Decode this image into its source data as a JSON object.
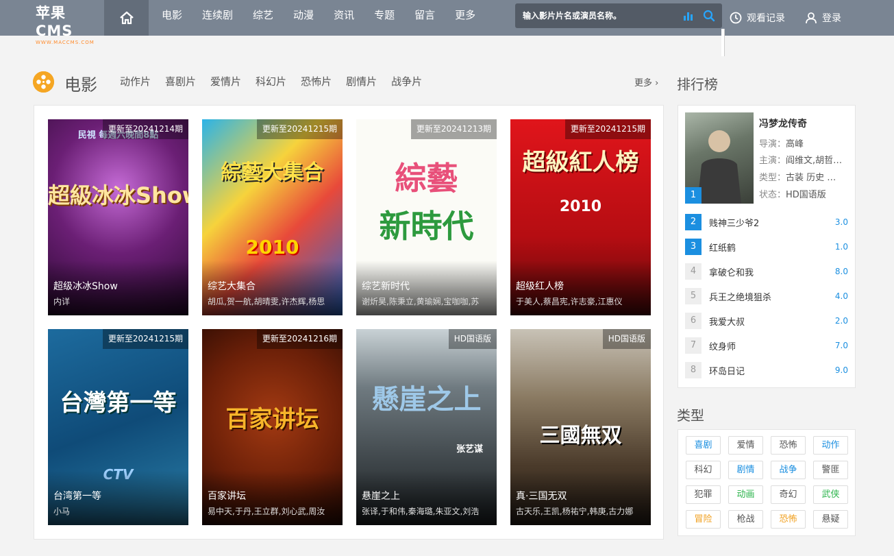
{
  "header": {
    "logo_main": "苹果 CMS",
    "logo_sub": "WWW.MACCMS.COM",
    "nav": [
      "电影",
      "连续剧",
      "综艺",
      "动漫",
      "资讯",
      "专题",
      "留言",
      "更多"
    ],
    "search_placeholder": "输入影片片名或演员名称。",
    "history_label": "观看记录",
    "login_label": "登录"
  },
  "section": {
    "title": "电影",
    "categories": [
      "动作片",
      "喜剧片",
      "爱情片",
      "科幻片",
      "恐怖片",
      "剧情片",
      "战争片"
    ],
    "more_label": "更多"
  },
  "cards": [
    {
      "title": "超级冰冰Show",
      "actors": "内详",
      "badge": "更新至20241214期",
      "art": "超級冰冰Show",
      "art_top": "民視 每週六晚間8點"
    },
    {
      "title": "综艺大集合",
      "actors": "胡瓜,贺一航,胡晴雯,许杰辉,杨思",
      "badge": "更新至20241215期",
      "art": "綜藝大集合",
      "art_top": "2010"
    },
    {
      "title": "综艺新时代",
      "actors": "谢炘昊,陈秉立,黄瑜娴,宝咖咖,苏",
      "badge": "更新至20241213期",
      "art": "綜藝",
      "art_top": "新時代"
    },
    {
      "title": "超级红人榜",
      "actors": "于美人,蔡昌宪,许志豪,江惠仪",
      "badge": "更新至20241215期",
      "art": "超級紅人榜",
      "art_top": "2010"
    },
    {
      "title": "台湾第一等",
      "actors": "小马",
      "badge": "更新至20241215期",
      "art": "台灣第一等",
      "art_top": "CTV"
    },
    {
      "title": "百家讲坛",
      "actors": "易中天,于丹,王立群,刘心武,周汝",
      "badge": "更新至20241216期",
      "art": "百家讲坛",
      "art_top": ""
    },
    {
      "title": "悬崖之上",
      "actors": "张译,于和伟,秦海璐,朱亚文,刘浩",
      "badge": "HD国语版",
      "art": "懸崖之上",
      "art_top": "张艺谋"
    },
    {
      "title": "真·三国无双",
      "actors": "古天乐,王凯,杨祐宁,韩庚,古力娜",
      "badge": "HD国语版",
      "art": "三國無双",
      "art_top": ""
    }
  ],
  "ranking": {
    "title": "排行榜",
    "top": {
      "rank": "1",
      "name": "冯梦龙传奇",
      "director_label": "导演：",
      "director": "高峰",
      "cast_label": "主演：",
      "cast": "阎维文,胡哲…",
      "type_label": "类型：",
      "type": "古装  历史  …",
      "status_label": "状态：",
      "status": "HD国语版"
    },
    "items": [
      {
        "rank": "2",
        "name": "贱神三少爷2",
        "score": "3.0"
      },
      {
        "rank": "3",
        "name": "红纸鹤",
        "score": "1.0"
      },
      {
        "rank": "4",
        "name": "拿破仑和我",
        "score": "8.0"
      },
      {
        "rank": "5",
        "name": "兵王之绝境狙杀",
        "score": "4.0"
      },
      {
        "rank": "6",
        "name": "我爱大叔",
        "score": "2.0"
      },
      {
        "rank": "7",
        "name": "纹身师",
        "score": "7.0"
      },
      {
        "rank": "8",
        "name": "环岛日记",
        "score": "9.0"
      }
    ]
  },
  "types": {
    "title": "类型",
    "tags": [
      {
        "label": "喜剧",
        "color": "#1b8fe0"
      },
      {
        "label": "爱情",
        "color": "#555555"
      },
      {
        "label": "恐怖",
        "color": "#555555"
      },
      {
        "label": "动作",
        "color": "#1b8fe0"
      },
      {
        "label": "科幻",
        "color": "#555555"
      },
      {
        "label": "剧情",
        "color": "#1b8fe0"
      },
      {
        "label": "战争",
        "color": "#1b8fe0"
      },
      {
        "label": "警匪",
        "color": "#555555"
      },
      {
        "label": "犯罪",
        "color": "#555555"
      },
      {
        "label": "动画",
        "color": "#2ab34a"
      },
      {
        "label": "奇幻",
        "color": "#555555"
      },
      {
        "label": "武侠",
        "color": "#2ab34a"
      },
      {
        "label": "冒险",
        "color": "#f0a020"
      },
      {
        "label": "枪战",
        "color": "#555555"
      },
      {
        "label": "恐怖",
        "color": "#f0a020"
      },
      {
        "label": "悬疑",
        "color": "#555555"
      }
    ]
  }
}
